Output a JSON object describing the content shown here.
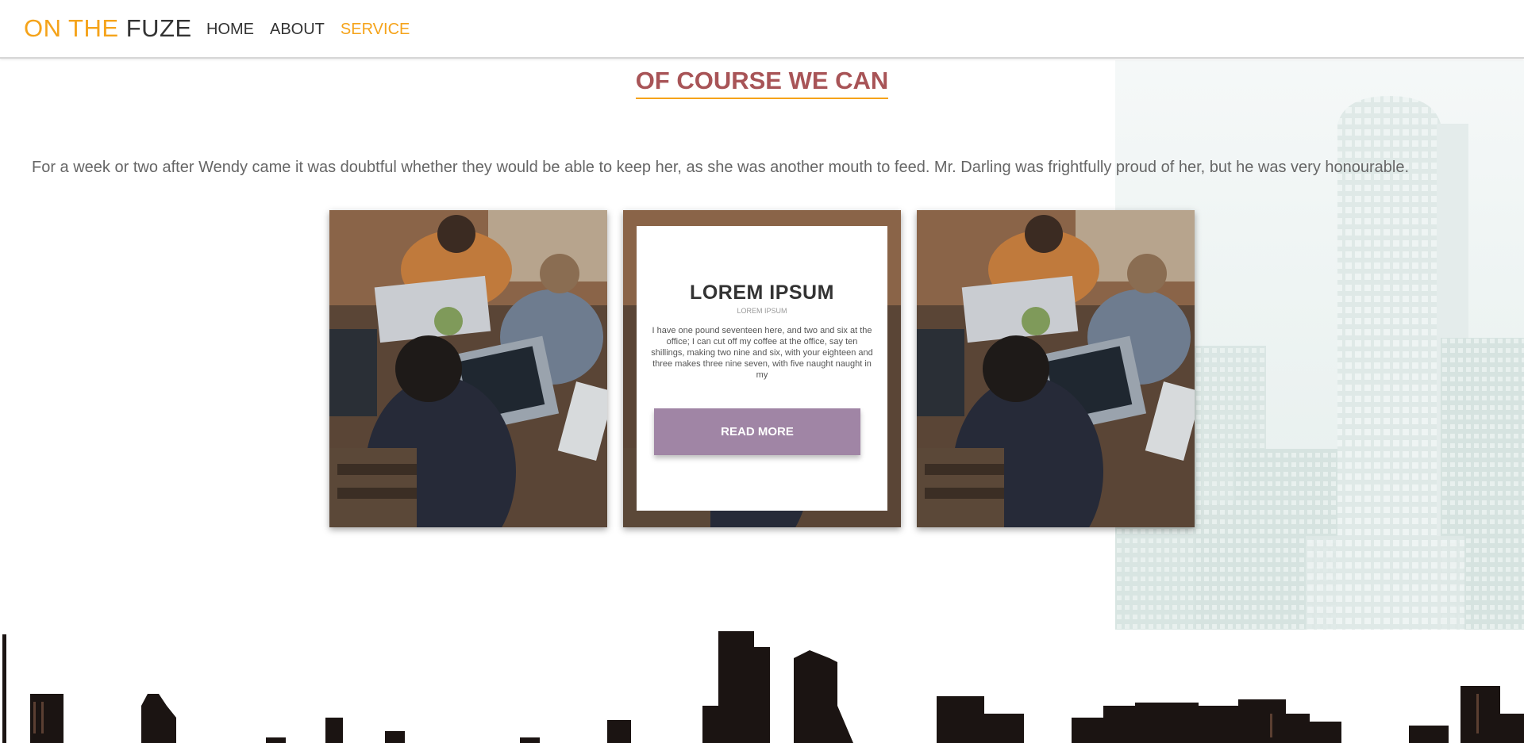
{
  "header": {
    "logo_part1": "ON THE",
    "logo_part2": "FUZE",
    "nav": [
      "HOME",
      "ABOUT",
      "SERVICE"
    ],
    "active_nav": "SERVICE"
  },
  "section": {
    "heading": "OF COURSE WE CAN",
    "paragraph": "For a week or two after Wendy came it was doubtful whether they would be able to keep her, as she was another mouth to feed. Mr. Darling was frightfully proud of her, but he was very honourable."
  },
  "card_overlay": {
    "title": "LOREM IPSUM",
    "subtitle": "LOREM IPSUM",
    "text": "I have one pound seventeen here, and two and six at the office; I can cut off my coffee at the office, say ten shillings, making two nine and six, with your eighteen and three makes three nine seven, with five naught naught in my",
    "button": "READ MORE"
  },
  "colors": {
    "accent": "#f5a31a",
    "heading": "#a85457",
    "button": "#a085a5"
  }
}
